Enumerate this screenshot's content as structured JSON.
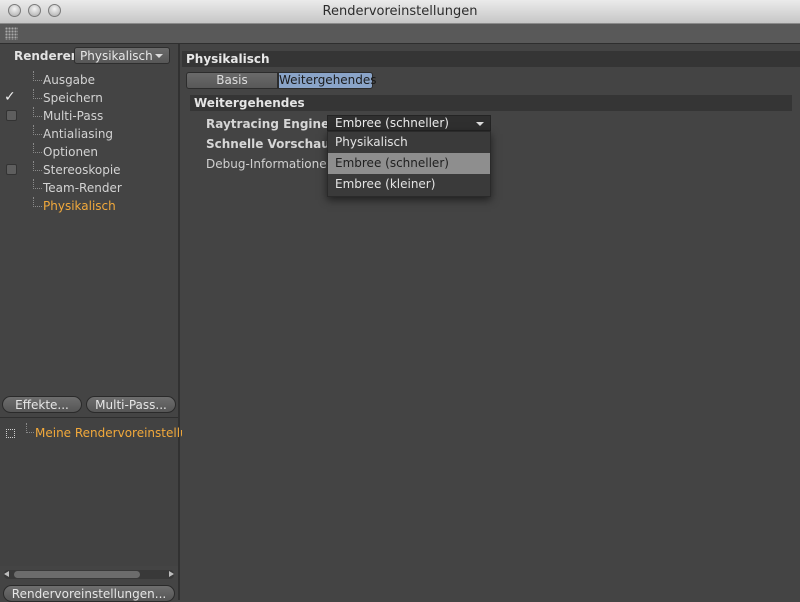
{
  "window": {
    "title": "Rendervoreinstellungen"
  },
  "sidebar": {
    "renderer_label": "Renderer",
    "renderer_value": "Physikalisch",
    "items": [
      {
        "label": "Ausgabe",
        "checkbox": "none"
      },
      {
        "label": "Speichern",
        "checkbox": "checked"
      },
      {
        "label": "Multi-Pass",
        "checkbox": "unchecked"
      },
      {
        "label": "Antialiasing",
        "checkbox": "none"
      },
      {
        "label": "Optionen",
        "checkbox": "none"
      },
      {
        "label": "Stereoskopie",
        "checkbox": "unchecked"
      },
      {
        "label": "Team-Render",
        "checkbox": "none"
      },
      {
        "label": "Physikalisch",
        "checkbox": "none",
        "active": true
      }
    ],
    "effects_button": "Effekte...",
    "multipass_button": "Multi-Pass...",
    "preset_name": "Meine Rendervoreinstellun",
    "presets_button": "Rendervoreinstellungen..."
  },
  "main": {
    "section_title": "Physikalisch",
    "tabs": [
      {
        "label": "Basis",
        "selected": false
      },
      {
        "label": "Weitergehendes",
        "selected": true
      }
    ],
    "group_title": "Weitergehendes",
    "fields": {
      "raytracing_label": "Raytracing Engine",
      "raytracing_value": "Embree (schneller)",
      "preview_label": "Schnelle Vorschau",
      "debug_label": "Debug-Informationen"
    },
    "dropdown_options": [
      {
        "label": "Physikalisch",
        "highlighted": false
      },
      {
        "label": "Embree (schneller)",
        "highlighted": true
      },
      {
        "label": "Embree (kleiner)",
        "highlighted": false
      }
    ]
  },
  "colors": {
    "accent_orange": "#f2a93b",
    "tab_selected": "#8aa4c8",
    "background": "#444444"
  },
  "icons": {
    "window_controls": [
      "close-icon",
      "minimize-icon",
      "zoom-icon"
    ],
    "grip": "grip-icon",
    "dropdown": "chevron-down-icon",
    "check": "checkmark-icon"
  }
}
